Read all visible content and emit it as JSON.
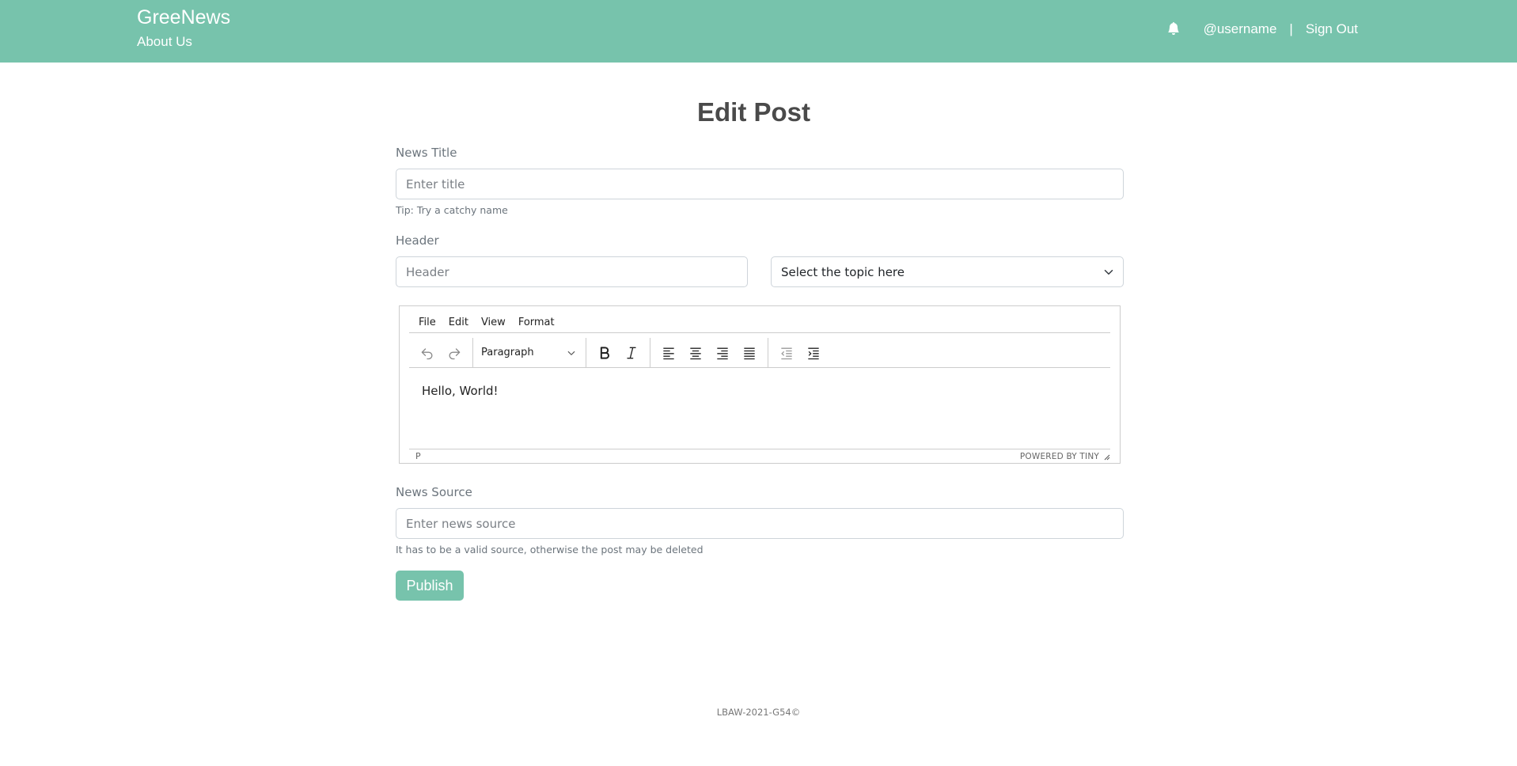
{
  "nav": {
    "brand": "GreeNews",
    "about": "About Us",
    "username": "@username",
    "separator": "|",
    "sign_out": "Sign Out",
    "icon": "bell-icon"
  },
  "page": {
    "title": "Edit Post"
  },
  "form": {
    "title_label": "News Title",
    "title_placeholder": "Enter title",
    "title_hint": "Tip: Try a catchy name",
    "header_label": "Header",
    "header_placeholder": "Header",
    "topic_selected": "Select the topic here",
    "source_label": "News Source",
    "source_placeholder": "Enter news source",
    "source_hint": "It has to be a valid source, otherwise the post may be deleted",
    "publish": "Publish"
  },
  "editor": {
    "menu": [
      "File",
      "Edit",
      "View",
      "Format"
    ],
    "block_format": "Paragraph",
    "content": "Hello, World!",
    "path": "P",
    "powered": "POWERED BY TINY"
  },
  "footer": {
    "text": "LBAW-2021-G54©"
  },
  "colors": {
    "brand": "#77c3ac"
  }
}
